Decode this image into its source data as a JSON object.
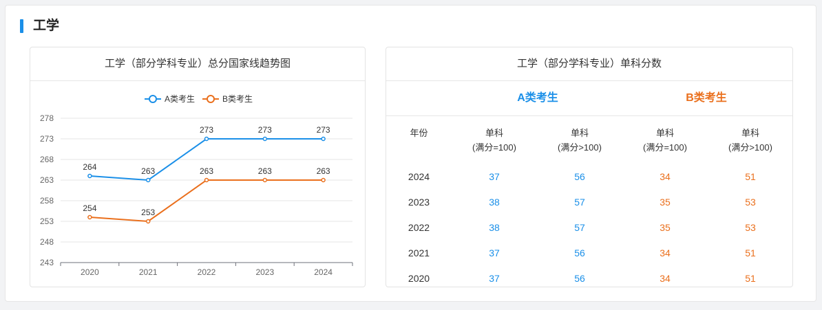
{
  "section": {
    "title": "工学"
  },
  "chart_card": {
    "title": "工学（部分学科专业）总分国家线趋势图"
  },
  "table_card": {
    "title": "工学（部分学科专业）单科分数",
    "group_a": "A类考生",
    "group_b": "B类考生",
    "headers": {
      "year": "年份",
      "a1": [
        "单科",
        "(满分=100)"
      ],
      "a2": [
        "单科",
        "(满分>100)"
      ],
      "b1": [
        "单科",
        "(满分=100)"
      ],
      "b2": [
        "单科",
        "(满分>100)"
      ]
    },
    "rows": [
      {
        "year": "2024",
        "a1": "37",
        "a2": "56",
        "b1": "34",
        "b2": "51"
      },
      {
        "year": "2023",
        "a1": "38",
        "a2": "57",
        "b1": "35",
        "b2": "53"
      },
      {
        "year": "2022",
        "a1": "38",
        "a2": "57",
        "b1": "35",
        "b2": "53"
      },
      {
        "year": "2021",
        "a1": "37",
        "a2": "56",
        "b1": "34",
        "b2": "51"
      },
      {
        "year": "2020",
        "a1": "37",
        "a2": "56",
        "b1": "34",
        "b2": "51"
      }
    ]
  },
  "colors": {
    "accent": "#1a8fe8",
    "series_a": "#1a8fe8",
    "series_b": "#ea6f1c"
  },
  "chart_data": {
    "type": "line",
    "title": "工学（部分学科专业）总分国家线趋势图",
    "xlabel": "",
    "ylabel": "",
    "categories": [
      "2020",
      "2021",
      "2022",
      "2023",
      "2024"
    ],
    "series": [
      {
        "name": "A类考生",
        "values": [
          264,
          263,
          273,
          273,
          273
        ],
        "color": "#1a8fe8"
      },
      {
        "name": "B类考生",
        "values": [
          254,
          253,
          263,
          263,
          263
        ],
        "color": "#ea6f1c"
      }
    ],
    "ylim": [
      243,
      278
    ],
    "yticks": [
      243,
      248,
      253,
      258,
      263,
      268,
      273,
      278
    ],
    "grid": true,
    "legend": "top-center",
    "data_labels": true
  }
}
